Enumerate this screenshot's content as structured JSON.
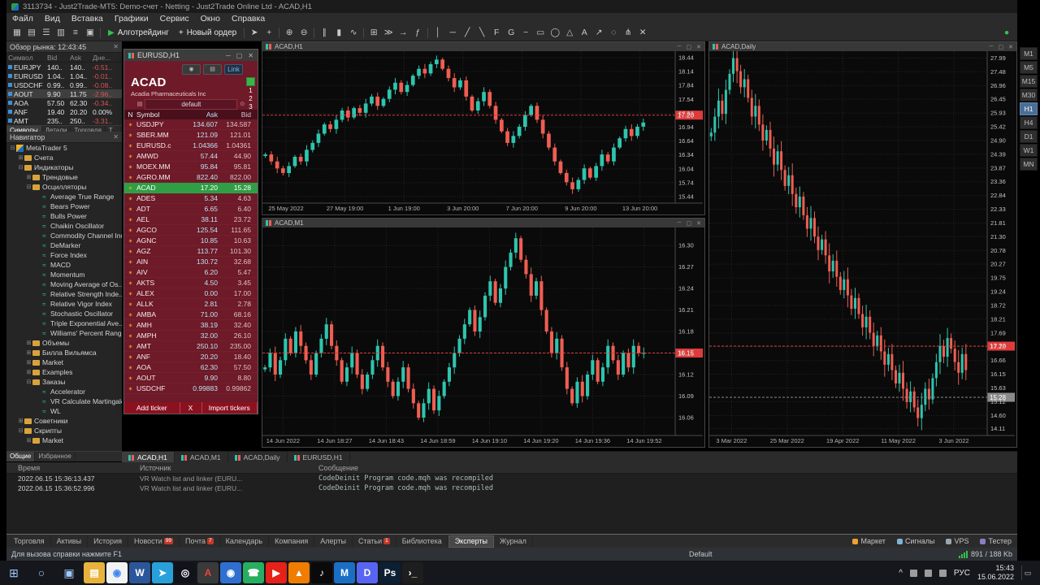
{
  "window": {
    "title": "3113734 - Just2Trade-MT5: Demo-счет - Netting - Just2Trade Online Ltd - ACAD,H1"
  },
  "icons": {
    "minimize": "─",
    "maximize": "▢",
    "close": "✕"
  },
  "menu": [
    "Файл",
    "Вид",
    "Вставка",
    "Графики",
    "Сервис",
    "Окно",
    "Справка"
  ],
  "toolbar": {
    "items": [
      {
        "k": "i",
        "n": "new-chart-icon",
        "g": "▦"
      },
      {
        "k": "i",
        "n": "profiles-icon",
        "g": "▤"
      },
      {
        "k": "i",
        "n": "market-watch-icon",
        "g": "☰"
      },
      {
        "k": "i",
        "n": "data-window-icon",
        "g": "▥"
      },
      {
        "k": "i",
        "n": "navigator-panel-icon",
        "g": "≡"
      },
      {
        "k": "i",
        "n": "toolbox-panel-icon",
        "g": "▣"
      },
      {
        "k": "s"
      },
      {
        "k": "b",
        "n": "algo-trading-button",
        "g": "▶",
        "gc": "#35c04b",
        "t": "Алготрейдинг"
      },
      {
        "k": "b",
        "n": "new-order-button",
        "g": "+",
        "gc": "#e8e8e8",
        "t": "Новый ордер"
      },
      {
        "k": "s"
      },
      {
        "k": "i",
        "n": "cursor-icon",
        "g": "➤"
      },
      {
        "k": "i",
        "n": "crosshair-icon",
        "g": "+"
      },
      {
        "k": "s"
      },
      {
        "k": "i",
        "n": "zoom-in-icon",
        "g": "⊕"
      },
      {
        "k": "i",
        "n": "zoom-out-icon",
        "g": "⊖"
      },
      {
        "k": "s"
      },
      {
        "k": "i",
        "n": "bar-chart-icon",
        "g": "∥"
      },
      {
        "k": "i",
        "n": "candle-chart-icon",
        "g": "▮"
      },
      {
        "k": "i",
        "n": "line-chart-icon",
        "g": "∿"
      },
      {
        "k": "s"
      },
      {
        "k": "i",
        "n": "tile-windows-icon",
        "g": "⊞"
      },
      {
        "k": "i",
        "n": "autoscroll-icon",
        "g": "≫"
      },
      {
        "k": "i",
        "n": "chart-shift-icon",
        "g": "→"
      },
      {
        "k": "i",
        "n": "indicators-icon",
        "g": "ƒ"
      },
      {
        "k": "s"
      },
      {
        "k": "i",
        "n": "vertical-line-icon",
        "g": "│"
      },
      {
        "k": "i",
        "n": "horizontal-line-icon",
        "g": "─"
      },
      {
        "k": "i",
        "n": "trendline-icon",
        "g": "╱"
      },
      {
        "k": "i",
        "n": "channel-icon",
        "g": "╲"
      },
      {
        "k": "i",
        "n": "fibonacci-icon",
        "g": "F"
      },
      {
        "k": "i",
        "n": "gann-icon",
        "g": "G"
      },
      {
        "k": "i",
        "n": "elliott-wave-icon",
        "g": "~"
      },
      {
        "k": "i",
        "n": "rectangle-icon",
        "g": "▭"
      },
      {
        "k": "i",
        "n": "ellipse-icon",
        "g": "◯"
      },
      {
        "k": "i",
        "n": "triangle-icon",
        "g": "△"
      },
      {
        "k": "i",
        "n": "text-icon",
        "g": "A"
      },
      {
        "k": "i",
        "n": "arrow-icon",
        "g": "↗"
      },
      {
        "k": "i",
        "n": "cycle-lines-icon",
        "g": "◌"
      },
      {
        "k": "i",
        "n": "pitchfork-icon",
        "g": "⋔"
      },
      {
        "k": "i",
        "n": "delete-object-icon",
        "g": "✕"
      },
      {
        "k": "sp"
      },
      {
        "k": "i",
        "n": "connection-status-icon",
        "g": "●",
        "gc": "#35c04b"
      }
    ]
  },
  "market_watch": {
    "title": "Обзор рынка: 12:43:45",
    "columns": [
      "Символ",
      "Bid",
      "Ask",
      "Дне..."
    ],
    "rows": [
      {
        "symbol": "EURJPY",
        "bid": "140..",
        "ask": "140..",
        "chg": "-0.51..",
        "selected": false
      },
      {
        "symbol": "EURUSD",
        "bid": "1.04..",
        "ask": "1.04..",
        "chg": "-0.01..",
        "selected": false
      },
      {
        "symbol": "USDCHF",
        "bid": "0.99..",
        "ask": "0.99..",
        "chg": "-0.08..",
        "selected": false
      },
      {
        "symbol": "AOUT",
        "bid": "9.90",
        "ask": "11.75",
        "chg": "-2.96..",
        "selected": true
      },
      {
        "symbol": "AOA",
        "bid": "57.50",
        "ask": "62.30",
        "chg": "-0.34..",
        "selected": false
      },
      {
        "symbol": "ANF",
        "bid": "19.40",
        "ask": "20.20",
        "chg": "0.00%",
        "selected": false,
        "flat": true
      },
      {
        "symbol": "AMT",
        "bid": "235..",
        "ask": "250..",
        "chg": "-3.31..",
        "selected": false
      }
    ],
    "tabs": [
      "Символы",
      "Детали",
      "Торговля",
      "Т..."
    ],
    "active_tab": "Символы"
  },
  "navigator": {
    "title": "Навигатор",
    "tree": [
      {
        "label": "MetaTrader 5",
        "depth": 0,
        "kind": "root",
        "exp": "⊟"
      },
      {
        "label": "Счета",
        "depth": 1,
        "kind": "folder",
        "exp": "⊞"
      },
      {
        "label": "Индикаторы",
        "depth": 1,
        "kind": "folder",
        "exp": "⊟"
      },
      {
        "label": "Трендовые",
        "depth": 2,
        "kind": "folder",
        "exp": "⊞"
      },
      {
        "label": "Осцилляторы",
        "depth": 2,
        "kind": "folder",
        "exp": "⊟"
      },
      {
        "label": "Average True Range",
        "depth": 3,
        "kind": "leaf"
      },
      {
        "label": "Bears Power",
        "depth": 3,
        "kind": "leaf"
      },
      {
        "label": "Bulls Power",
        "depth": 3,
        "kind": "leaf"
      },
      {
        "label": "Chaikin Oscillator",
        "depth": 3,
        "kind": "leaf"
      },
      {
        "label": "Commodity Channel Index",
        "depth": 3,
        "kind": "leaf"
      },
      {
        "label": "DeMarker",
        "depth": 3,
        "kind": "leaf"
      },
      {
        "label": "Force Index",
        "depth": 3,
        "kind": "leaf"
      },
      {
        "label": "MACD",
        "depth": 3,
        "kind": "leaf"
      },
      {
        "label": "Momentum",
        "depth": 3,
        "kind": "leaf"
      },
      {
        "label": "Moving Average of Os...",
        "depth": 3,
        "kind": "leaf"
      },
      {
        "label": "Relative Strength Inde...",
        "depth": 3,
        "kind": "leaf"
      },
      {
        "label": "Relative Vigor Index",
        "depth": 3,
        "kind": "leaf"
      },
      {
        "label": "Stochastic Oscillator",
        "depth": 3,
        "kind": "leaf"
      },
      {
        "label": "Triple Exponential Ave...",
        "depth": 3,
        "kind": "leaf"
      },
      {
        "label": "Williams' Percent Rang...",
        "depth": 3,
        "kind": "leaf"
      },
      {
        "label": "Объемы",
        "depth": 2,
        "kind": "folder",
        "exp": "⊞"
      },
      {
        "label": "Билла Вильямса",
        "depth": 2,
        "kind": "folder",
        "exp": "⊞"
      },
      {
        "label": "Market",
        "depth": 2,
        "kind": "folder",
        "exp": "⊞"
      },
      {
        "label": "Examples",
        "depth": 2,
        "kind": "folder",
        "exp": "⊞"
      },
      {
        "label": "Заказы",
        "depth": 2,
        "kind": "folder",
        "exp": "⊟"
      },
      {
        "label": "Accelerator",
        "depth": 3,
        "kind": "leaf"
      },
      {
        "label": "VR Calculate Martingale",
        "depth": 3,
        "kind": "leaf"
      },
      {
        "label": "WL",
        "depth": 3,
        "kind": "leaf"
      },
      {
        "label": "Советники",
        "depth": 1,
        "kind": "folder",
        "exp": "⊞"
      },
      {
        "label": "Скрипты",
        "depth": 1,
        "kind": "folder",
        "exp": "⊟"
      },
      {
        "label": "Market",
        "depth": 2,
        "kind": "folder",
        "exp": "⊞"
      }
    ],
    "tabs": [
      "Общие",
      "Избранное"
    ],
    "active_tab": "Общие"
  },
  "watchlist_window": {
    "title": "EURUSD,H1",
    "camera_icon": "◉",
    "layout_icon": "▤",
    "link_label": "Link",
    "symbol": "ACAD",
    "company": "Acadia Pharmaceuticals Inc",
    "side_numbers": [
      "1",
      "2",
      "3"
    ],
    "preset": "default",
    "columns": [
      "N",
      "Symbol",
      "Ask",
      "Bid"
    ],
    "rows": [
      {
        "symbol": "USDJPY",
        "ask": "134.607",
        "bid": "134.587"
      },
      {
        "symbol": "SBER.MM",
        "ask": "121.09",
        "bid": "121.01"
      },
      {
        "symbol": "EURUSD.c",
        "ask": "1.04366",
        "bid": "1.04361"
      },
      {
        "symbol": "AMWD",
        "ask": "57.44",
        "bid": "44.90"
      },
      {
        "symbol": "MOEX.MM",
        "ask": "95.84",
        "bid": "95.81"
      },
      {
        "symbol": "AGRO.MM",
        "ask": "822.40",
        "bid": "822.00"
      },
      {
        "symbol": "ACAD",
        "ask": "17.20",
        "bid": "15.28",
        "selected": true
      },
      {
        "symbol": "ADES",
        "ask": "5.34",
        "bid": "4.63"
      },
      {
        "symbol": "ADT",
        "ask": "6.65",
        "bid": "6.40"
      },
      {
        "symbol": "AEL",
        "ask": "38.11",
        "bid": "23.72"
      },
      {
        "symbol": "AGCO",
        "ask": "125.54",
        "bid": "111.65"
      },
      {
        "symbol": "AGNC",
        "ask": "10.85",
        "bid": "10.63"
      },
      {
        "symbol": "AGZ",
        "ask": "113.77",
        "bid": "101.30"
      },
      {
        "symbol": "AIN",
        "ask": "130.72",
        "bid": "32.68"
      },
      {
        "symbol": "AIV",
        "ask": "6.20",
        "bid": "5.47"
      },
      {
        "symbol": "AKTS",
        "ask": "4.50",
        "bid": "3.45"
      },
      {
        "symbol": "ALEX",
        "ask": "0.00",
        "bid": "17.00"
      },
      {
        "symbol": "ALLK",
        "ask": "2.81",
        "bid": "2.78"
      },
      {
        "symbol": "AMBA",
        "ask": "71.00",
        "bid": "68.16"
      },
      {
        "symbol": "AMH",
        "ask": "38.19",
        "bid": "32.40"
      },
      {
        "symbol": "AMPH",
        "ask": "32.00",
        "bid": "26.10"
      },
      {
        "symbol": "AMT",
        "ask": "250.10",
        "bid": "235.00"
      },
      {
        "symbol": "ANF",
        "ask": "20.20",
        "bid": "18.40"
      },
      {
        "symbol": "AOA",
        "ask": "62.30",
        "bid": "57.50"
      },
      {
        "symbol": "AOUT",
        "ask": "9.90",
        "bid": "8.80"
      },
      {
        "symbol": "USDCHF",
        "ask": "0.99883",
        "bid": "0.99862"
      }
    ],
    "footer": {
      "add": "Add ticker",
      "x": "X",
      "import": "Import tickers"
    }
  },
  "chart_data": [
    {
      "id": "h1",
      "type": "candlestick",
      "title": "ACAD,H1",
      "ylim": [
        15.3,
        18.58
      ],
      "price_labels": [
        18.44,
        18.14,
        17.84,
        17.54,
        17.24,
        16.94,
        16.64,
        16.34,
        16.04,
        15.74,
        15.44
      ],
      "time_labels": [
        "25 May 2022",
        "27 May 19:00",
        "1 Jun 19:00",
        "3 Jun 20:00",
        "7 Jun 20:00",
        "9 Jun 20:00",
        "13 Jun 20:00"
      ],
      "closes": [
        16.35,
        16.2,
        16.05,
        15.95,
        16.1,
        16.3,
        16.2,
        16.45,
        16.6,
        16.8,
        17.0,
        16.9,
        17.1,
        17.3,
        17.15,
        17.35,
        17.25,
        17.45,
        17.6,
        17.4,
        17.55,
        17.75,
        17.9,
        17.7,
        17.85,
        18.05,
        18.2,
        18.1,
        18.3,
        18.4,
        18.2,
        18.0,
        17.8,
        17.95,
        17.6,
        17.3,
        17.5,
        17.7,
        17.4,
        17.1,
        16.85,
        16.6,
        16.75,
        16.95,
        17.2,
        17.4,
        17.1,
        16.8,
        16.5,
        16.2,
        15.95,
        15.75,
        15.6,
        15.8,
        16.05,
        15.85,
        16.1,
        16.35,
        16.2,
        16.5,
        16.7,
        16.9,
        16.75,
        16.95,
        17.04
      ],
      "red_price": 17.2
    },
    {
      "id": "m1",
      "type": "candlestick",
      "title": "ACAD,M1",
      "ylim": [
        16.035,
        16.325
      ],
      "price_labels": [
        16.3,
        16.27,
        16.24,
        16.21,
        16.18,
        16.15,
        16.12,
        16.09,
        16.06
      ],
      "time_labels": [
        "14 Jun 2022",
        "14 Jun 18:27",
        "14 Jun 18:43",
        "14 Jun 18:59",
        "14 Jun 19:10",
        "14 Jun 19:20",
        "14 Jun 19:36",
        "14 Jun 19:52"
      ],
      "closes": [
        16.13,
        16.15,
        16.12,
        16.14,
        16.17,
        16.15,
        16.18,
        16.16,
        16.14,
        16.12,
        16.15,
        16.17,
        16.19,
        16.16,
        16.14,
        16.11,
        16.13,
        16.15,
        16.12,
        16.1,
        16.12,
        16.14,
        16.16,
        16.13,
        16.11,
        16.09,
        16.11,
        16.13,
        16.1,
        16.08,
        16.06,
        16.08,
        16.1,
        16.07,
        16.09,
        16.11,
        16.13,
        16.15,
        16.17,
        16.19,
        16.21,
        16.18,
        16.2,
        16.23,
        16.25,
        16.22,
        16.24,
        16.27,
        16.29,
        16.31,
        16.28,
        16.26,
        16.23,
        16.25,
        16.21,
        16.18,
        16.15,
        16.17,
        16.13,
        16.1,
        16.08,
        16.11,
        16.09,
        16.12,
        16.14,
        16.11,
        16.13,
        16.16,
        16.14,
        16.12,
        16.15,
        16.13,
        16.16,
        16.15,
        16.15
      ],
      "red_price": 16.15
    },
    {
      "id": "daily",
      "type": "candlestick",
      "title": "ACAD,Daily",
      "ylim": [
        13.85,
        28.25
      ],
      "price_labels": [
        27.99,
        27.48,
        26.96,
        26.45,
        25.93,
        25.42,
        24.9,
        24.39,
        23.87,
        23.36,
        22.84,
        22.33,
        21.81,
        21.3,
        20.78,
        20.27,
        19.75,
        19.24,
        18.72,
        18.21,
        17.69,
        17.18,
        16.66,
        16.15,
        15.63,
        15.12,
        14.6,
        14.11
      ],
      "time_labels": [
        "3 Mar 2022",
        "25 Mar 2022",
        "19 Apr 2022",
        "11 May 2022",
        "3 Jun 2022"
      ],
      "closes": [
        25.2,
        25.8,
        26.4,
        25.9,
        26.8,
        27.4,
        27.99,
        27.5,
        26.9,
        27.2,
        26.5,
        25.8,
        26.2,
        25.5,
        24.9,
        25.3,
        24.6,
        24.0,
        24.5,
        23.8,
        23.2,
        23.6,
        22.9,
        22.4,
        22.8,
        22.1,
        21.6,
        22.0,
        21.3,
        20.8,
        21.2,
        20.6,
        20.0,
        20.4,
        19.8,
        19.3,
        19.7,
        19.1,
        18.6,
        19.0,
        18.4,
        17.9,
        18.3,
        17.7,
        17.2,
        17.6,
        17.0,
        16.5,
        16.9,
        16.3,
        15.8,
        16.2,
        15.6,
        15.1,
        15.5,
        14.9,
        14.5,
        15.0,
        15.6,
        15.2,
        16.0,
        16.6,
        17.2,
        16.8,
        17.5,
        17.1,
        16.6,
        16.2,
        16.9,
        16.3
      ],
      "red_price": 17.2,
      "grey_price": 15.28
    }
  ],
  "timeframes": {
    "items": [
      "M1",
      "M5",
      "M15",
      "M30",
      "H1",
      "H4",
      "D1",
      "W1",
      "MN"
    ],
    "active": "H1"
  },
  "chart_tabs": {
    "items": [
      "ACAD,H1",
      "ACAD,M1",
      "ACAD,Daily",
      "EURUSD,H1"
    ],
    "active": "ACAD,H1"
  },
  "journal": {
    "columns": [
      "Время",
      "Источник",
      "Сообщение"
    ],
    "rows": [
      {
        "time": "2022.06.15 15:36:13.437",
        "source": "VR Watch list and linker (EURU...",
        "message": "CodeDeinit  Program code.mqh was recompiled"
      },
      {
        "time": "2022.06.15 15:36:52.996",
        "source": "VR Watch list and linker (EURU...",
        "message": "CodeDeinit  Program code.mqh was recompiled"
      }
    ]
  },
  "bottom_tabs": {
    "items": [
      {
        "label": "Торговля"
      },
      {
        "label": "Активы"
      },
      {
        "label": "История"
      },
      {
        "label": "Новости",
        "badge": "99"
      },
      {
        "label": "Почта",
        "badge": "7"
      },
      {
        "label": "Календарь"
      },
      {
        "label": "Компания"
      },
      {
        "label": "Алерты"
      },
      {
        "label": "Статьи",
        "badge": "1"
      },
      {
        "label": "Библиотека"
      },
      {
        "label": "Эксперты",
        "active": true
      },
      {
        "label": "Журнал"
      }
    ],
    "right_tools": [
      {
        "name": "market-store",
        "label": "Маркет",
        "color": "#f0a030"
      },
      {
        "name": "signals",
        "label": "Сигналы",
        "color": "#7fb3d5"
      },
      {
        "name": "vps",
        "label": "VPS",
        "color": "#9aa7b0"
      },
      {
        "name": "tester",
        "label": "Тестер",
        "color": "#8e7cc3"
      }
    ]
  },
  "status_bar": {
    "help": "Для вызова справки нажмите F1",
    "profile": "Default",
    "traffic": "891 / 188 Kb"
  },
  "taskbar": {
    "start_glyph": "⊞",
    "search_glyph": "○",
    "taskview_glyph": "▣",
    "apps": [
      {
        "name": "file-explorer",
        "bg": "#e8b33c",
        "glyph": "▤"
      },
      {
        "name": "chrome-browser",
        "bg": "#f1f3f4",
        "glyph": "◉",
        "fg": "#4285f4"
      },
      {
        "name": "word",
        "bg": "#2b579a",
        "glyph": "W"
      },
      {
        "name": "telegram",
        "bg": "#29a0da",
        "glyph": "➤"
      },
      {
        "name": "obs-studio",
        "bg": "#10131a",
        "glyph": "◎"
      },
      {
        "name": "acrobat-reader",
        "bg": "#3a3a3a",
        "glyph": "A",
        "fg": "#e8453c"
      },
      {
        "name": "camera-app",
        "bg": "#2f6fd0",
        "glyph": "◉"
      },
      {
        "name": "whatsapp",
        "bg": "#27ae60",
        "glyph": "☎"
      },
      {
        "name": "youtube",
        "bg": "#e62117",
        "glyph": "▶"
      },
      {
        "name": "vlc",
        "bg": "#ef7d00",
        "glyph": "▲"
      },
      {
        "name": "tiktok",
        "bg": "#0a0a0a",
        "glyph": "♪"
      },
      {
        "name": "metatrader5",
        "bg": "#1a6fc4",
        "glyph": "M"
      },
      {
        "name": "discord",
        "bg": "#5865f2",
        "glyph": "D"
      },
      {
        "name": "photoshop",
        "bg": "#0c1f33",
        "glyph": "Ps"
      },
      {
        "name": "terminal",
        "bg": "#1e1e1e",
        "glyph": "›_"
      }
    ],
    "lang": "РУС",
    "time": "15:43",
    "date": "15.06.2022"
  },
  "colors": {
    "up": "#2ec5ae",
    "down": "#ef5e52",
    "ask_line": "#e03b3b",
    "bid_line": "#8a8a8a",
    "maroon": "#6e1a28"
  }
}
